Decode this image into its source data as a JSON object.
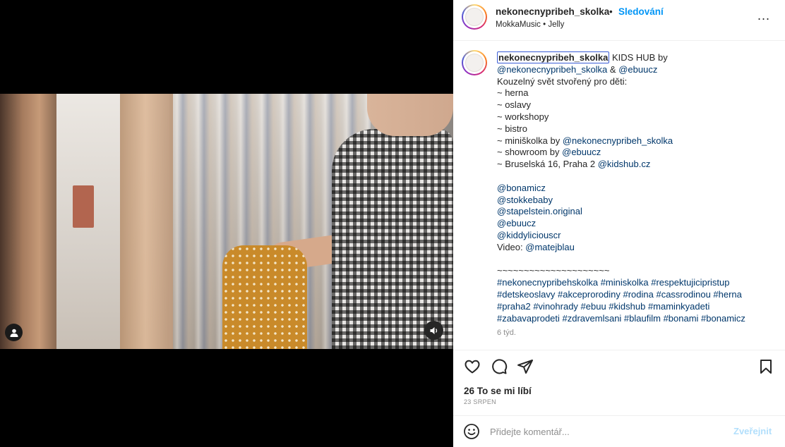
{
  "header": {
    "username": "nekonecnypribeh_skolka",
    "dot": "•",
    "follow_label": "Sledování",
    "subtitle": "MokkaMusic • Jelly",
    "more_label": "..."
  },
  "caption": {
    "username": "nekonecnypribeh_skolka",
    "first_line_text": " KIDS HUB by",
    "line2_mention1": "@nekonecnypribeh_skolka",
    "line2_amp": " & ",
    "line2_mention2": "@ebuucz",
    "line3": "Kouzelný svět stvořený pro děti:",
    "list": [
      "~ herna",
      "~ oslavy",
      "~ workshopy",
      "~ bistro"
    ],
    "miniskolka_prefix": "~ miniškolka by ",
    "miniskolka_mention": "@nekonecnypribeh_skolka",
    "showroom_prefix": "~ showroom by ",
    "showroom_mention": "@ebuucz",
    "address_prefix": "~ Bruselská 16, Praha 2 ",
    "address_mention": "@kidshub.cz",
    "mentions": [
      "@bonamicz",
      "@stokkebaby",
      "@stapelstein.original",
      "@ebuucz",
      "@kiddyliciouscr"
    ],
    "video_prefix": "Video: ",
    "video_mention": "@matejblau",
    "separator": "~~~~~~~~~~~~~~~~~~~~~",
    "hashtag_lines": [
      "#nekonecnypribehskolka #miniskolka #respektujicipristup",
      "#detskeoslavy #akceprorodiny #rodina #cassrodinou #herna",
      "#praha2 #vinohrady #ebuu #kidshub #maminkyadeti",
      "#zabavaprodeti #zdravemlsani #blaufilm #bonami #bonamicz"
    ],
    "time": "6 týd."
  },
  "actions": {
    "likes": "26 To se mi líbí",
    "date": "23 SRPEN"
  },
  "comment": {
    "placeholder": "Přidejte komentář...",
    "post_label": "Zveřejnit"
  },
  "icons": {
    "user_tag": "user-tag-icon",
    "mute": "speaker-icon",
    "like": "heart-icon",
    "comment": "comment-icon",
    "share": "paper-plane-icon",
    "save": "bookmark-icon",
    "emoji": "smiley-icon"
  },
  "colors": {
    "accent": "#0095f6",
    "link": "#00376b",
    "muted": "#8e8e8e",
    "post_disabled": "#b2dffc"
  }
}
